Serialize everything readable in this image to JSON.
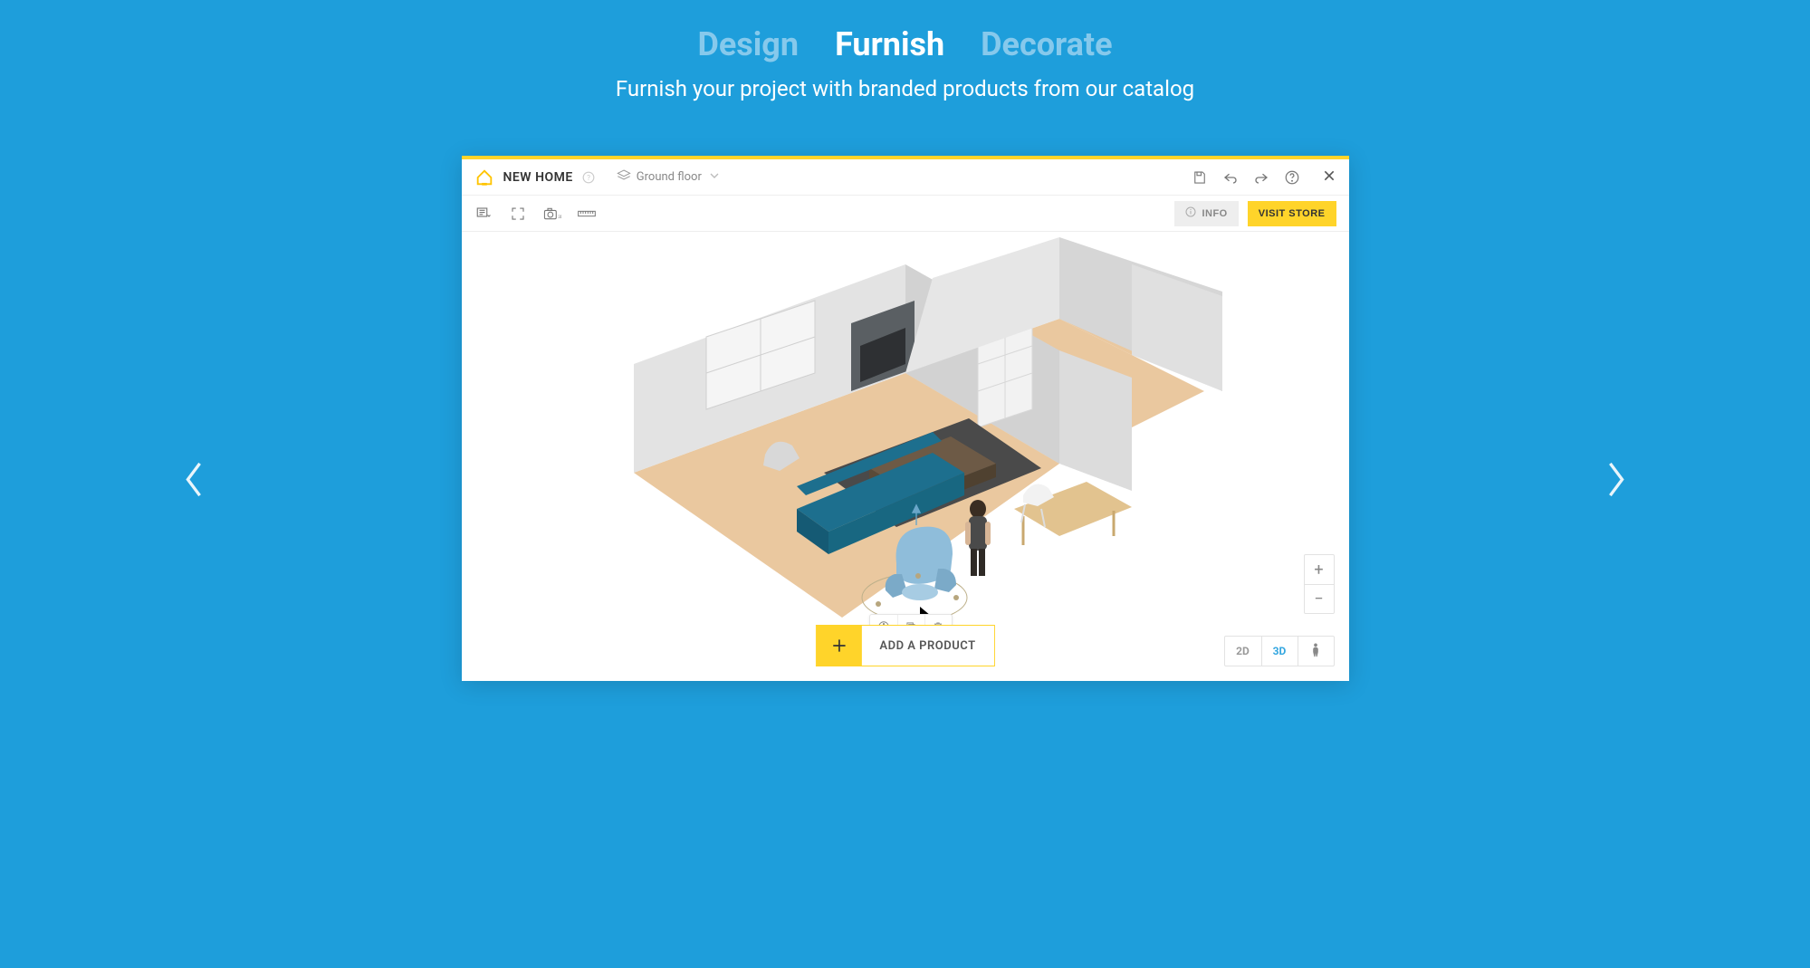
{
  "tabs": {
    "design": "Design",
    "furnish": "Furnish",
    "decorate": "Decorate"
  },
  "subtitle": "Furnish your project with branded products from our catalog",
  "titlebar": {
    "project_name": "NEW HOME",
    "floor_label": "Ground floor"
  },
  "toolbar": {
    "info_label": "INFO",
    "visit_store_label": "VISIT STORE"
  },
  "add_product_label": "ADD A PRODUCT",
  "zoom": {
    "in": "+",
    "out": "−"
  },
  "view_mode": {
    "two_d": "2D",
    "three_d": "3D"
  }
}
